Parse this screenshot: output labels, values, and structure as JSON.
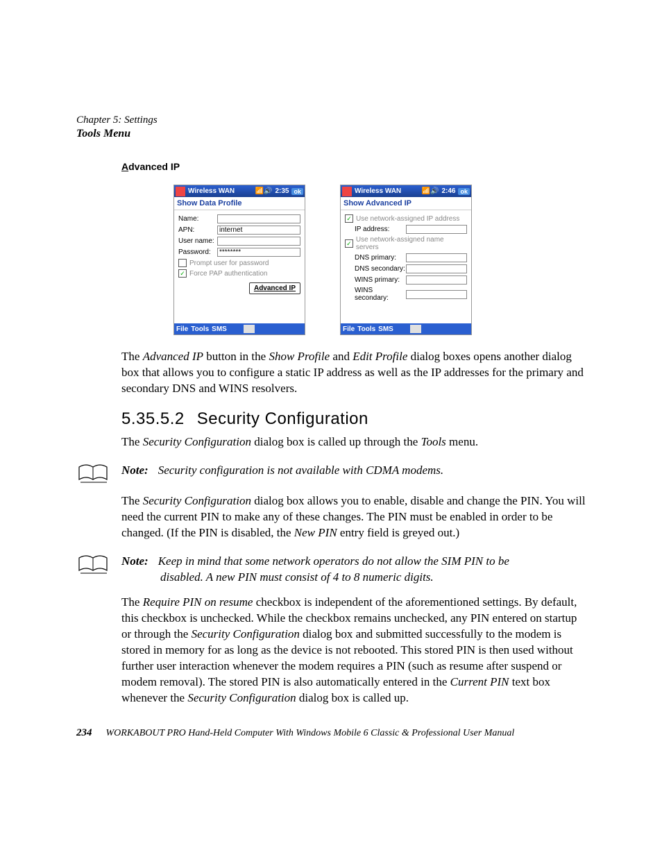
{
  "header": {
    "chapter": "Chapter 5: Settings",
    "section": "Tools Menu"
  },
  "heading_advanced_ip": "Advanced IP",
  "screenshot_left": {
    "titlebar_title": "Wireless WAN",
    "titlebar_time": "2:35",
    "titlebar_ok": "ok",
    "subbar": "Show Data Profile",
    "fields": {
      "name_label": "Name:",
      "name_value": "",
      "apn_label": "APN:",
      "apn_value": "internet",
      "username_label": "User name:",
      "username_value": "",
      "password_label": "Password:",
      "password_value": "********"
    },
    "chk_prompt": "Prompt user for password",
    "chk_force": "Force PAP authentication",
    "advanced_button": "Advanced IP",
    "bottom_menus": [
      "File",
      "Tools",
      "SMS"
    ]
  },
  "screenshot_right": {
    "titlebar_title": "Wireless WAN",
    "titlebar_time": "2:46",
    "titlebar_ok": "ok",
    "subbar": "Show Advanced IP",
    "chk_ip": "Use network-assigned IP address",
    "ip_label": "IP address:",
    "chk_ns": "Use network-assigned name servers",
    "dns_primary": "DNS primary:",
    "dns_secondary": "DNS secondary:",
    "wins_primary": "WINS primary:",
    "wins_secondary": "WINS secondary:",
    "bottom_menus": [
      "File",
      "Tools",
      "SMS"
    ]
  },
  "para_after_screens": {
    "t1": "The ",
    "i1": "Advanced IP",
    "t2": " button in the ",
    "i2": "Show Profile",
    "t3": " and ",
    "i3": "Edit Profile",
    "t4": " dialog boxes opens another dialog box that allows you to configure a static IP address as well as the IP addresses for the primary and secondary DNS and WINS resolvers."
  },
  "h3": {
    "num": "5.35.5.2",
    "title": "Security Configuration"
  },
  "para_sec_intro": {
    "t1": "The ",
    "i1": "Security Configuration",
    "t2": " dialog box is called up through the ",
    "i2": "Tools",
    "t3": " menu."
  },
  "note1": {
    "label": "Note:",
    "text": "Security configuration is not available with CDMA modems."
  },
  "para_sec_body": {
    "t1": "The ",
    "i1": "Security Configuration",
    "t2": " dialog box allows you to enable, disable and change the PIN. You will need the current PIN to make any of these changes. The PIN must be enabled in order to be changed. (If the PIN is disabled, the ",
    "i2": "New PIN",
    "t3": " entry field is greyed out.)"
  },
  "note2": {
    "label": "Note:",
    "line1": "Keep in mind that some network operators do not allow the SIM PIN to be",
    "line2": "disabled. A new PIN must consist of 4 to 8 numeric digits."
  },
  "para_require_pin": {
    "t1": "The ",
    "i1": "Require PIN on resume",
    "t2": " checkbox is independent of the aforementioned settings. By default, this checkbox is unchecked. While the checkbox remains unchecked, any PIN entered on startup or through the ",
    "i2": "Security Configuration",
    "t3": " dialog box and submitted successfully to the modem is stored in memory for as long as the device is not rebooted. This stored PIN is then used without further user interaction whenever the modem requires a PIN (such as resume after suspend or modem removal). The stored PIN is also automatically entered in the ",
    "i3": "Current PIN",
    "t4": " text box whenever the ",
    "i4": "Security Configuration",
    "t5": " dialog box is called up."
  },
  "footer": {
    "page": "234",
    "text": "WORKABOUT PRO Hand-Held Computer With Windows Mobile 6 Classic & Professional User Manual"
  }
}
